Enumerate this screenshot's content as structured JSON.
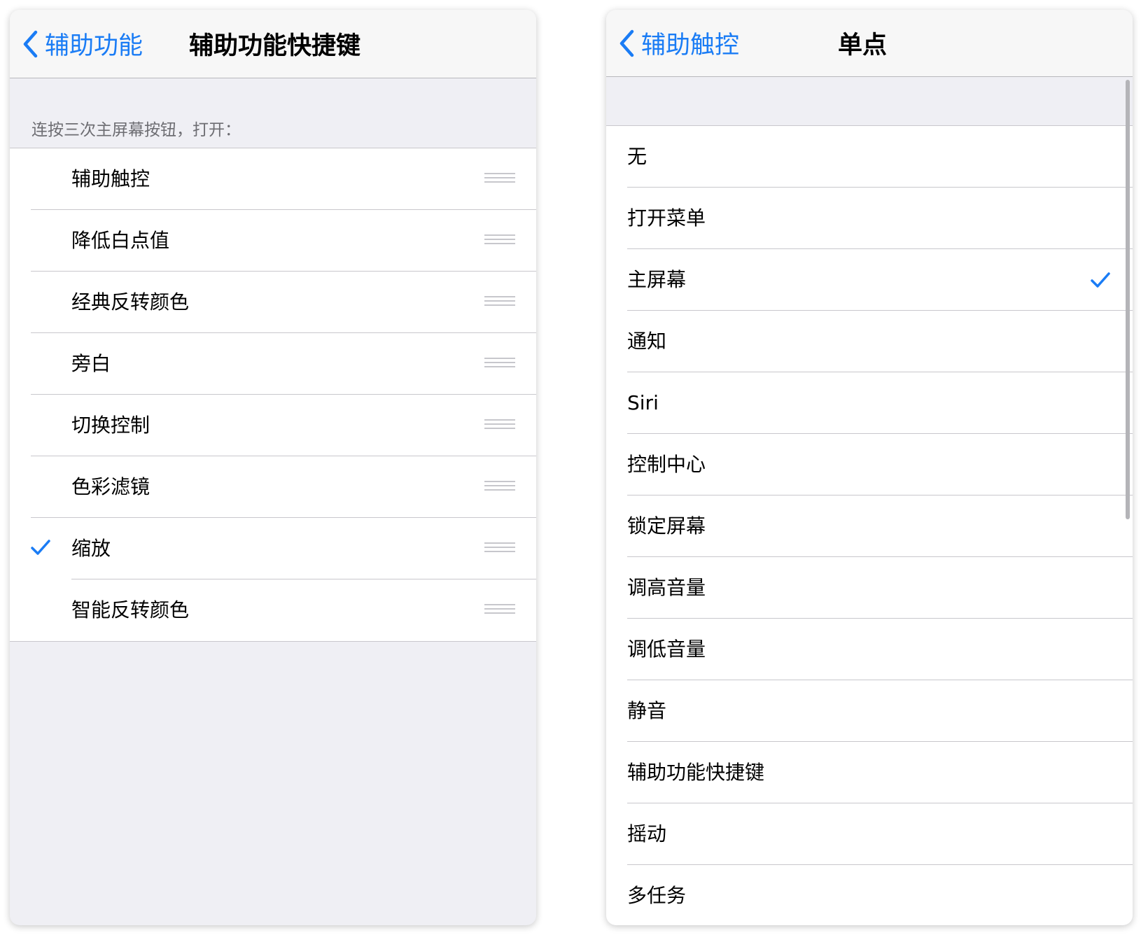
{
  "left": {
    "back_label": "辅助功能",
    "title": "辅助功能快捷键",
    "section_header": "连按三次主屏幕按钮，打开：",
    "items": [
      {
        "label": "辅助触控",
        "checked": false
      },
      {
        "label": "降低白点值",
        "checked": false
      },
      {
        "label": "经典反转颜色",
        "checked": false
      },
      {
        "label": "旁白",
        "checked": false
      },
      {
        "label": "切换控制",
        "checked": false
      },
      {
        "label": "色彩滤镜",
        "checked": false
      },
      {
        "label": "缩放",
        "checked": true
      },
      {
        "label": "智能反转颜色",
        "checked": false
      }
    ]
  },
  "right": {
    "back_label": "辅助触控",
    "title": "单点",
    "items": [
      {
        "label": "无",
        "checked": false
      },
      {
        "label": "打开菜单",
        "checked": false
      },
      {
        "label": "主屏幕",
        "checked": true
      },
      {
        "label": "通知",
        "checked": false
      },
      {
        "label": "Siri",
        "checked": false
      },
      {
        "label": "控制中心",
        "checked": false
      },
      {
        "label": "锁定屏幕",
        "checked": false
      },
      {
        "label": "调高音量",
        "checked": false
      },
      {
        "label": "调低音量",
        "checked": false
      },
      {
        "label": "静音",
        "checked": false
      },
      {
        "label": "辅助功能快捷键",
        "checked": false
      },
      {
        "label": "摇动",
        "checked": false
      },
      {
        "label": "多任务",
        "checked": false
      }
    ]
  },
  "colors": {
    "accent": "#1a7cf5",
    "background": "#efeff4",
    "separator": "#c8c7cc"
  }
}
